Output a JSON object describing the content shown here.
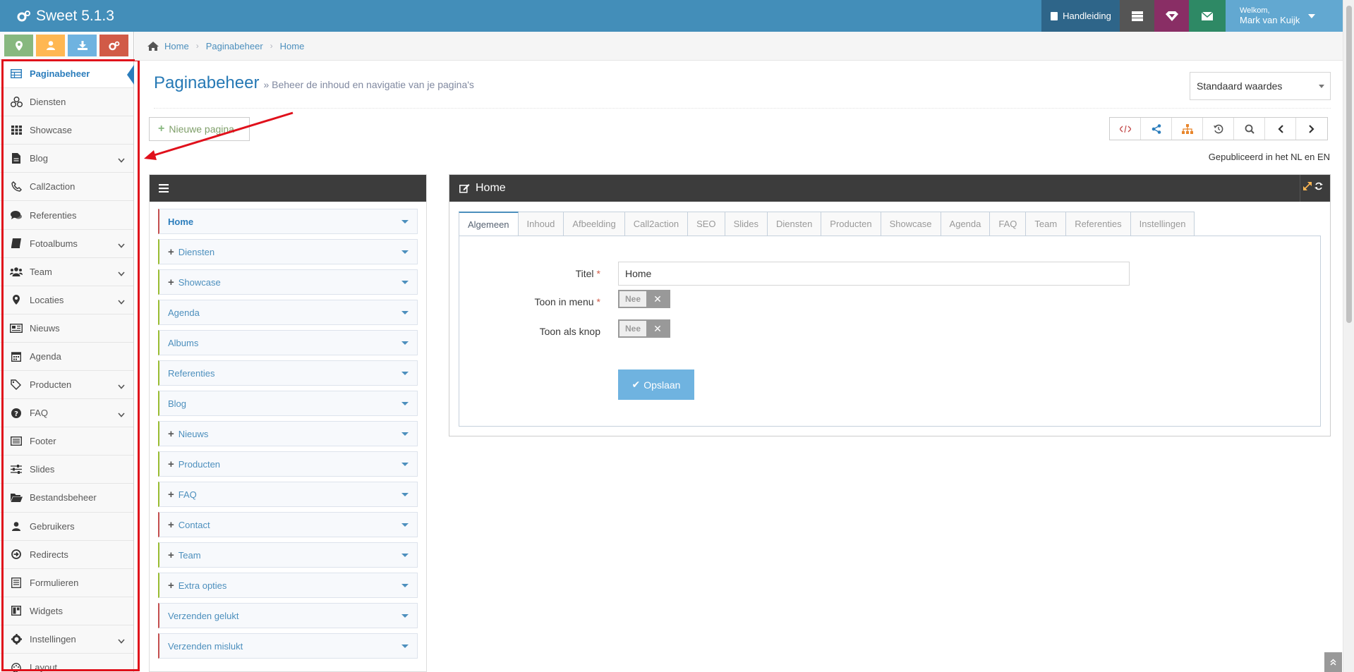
{
  "app": {
    "title": "Sweet 5.1.3",
    "manual_label": "Handleiding",
    "welcome": "Welkom,",
    "user_name": "Mark van Kuijk"
  },
  "colors": {
    "topbar": "#438eb9",
    "accent": "#2b7dbc",
    "highlight": "#e0101b"
  },
  "sidebar": {
    "items": [
      {
        "label": "Paginabeheer",
        "icon": "table-icon",
        "active": true,
        "submenu": false
      },
      {
        "label": "Diensten",
        "icon": "cubes-icon",
        "submenu": false
      },
      {
        "label": "Showcase",
        "icon": "grid-icon",
        "submenu": false
      },
      {
        "label": "Blog",
        "icon": "file-icon",
        "submenu": true
      },
      {
        "label": "Call2action",
        "icon": "phone-icon",
        "submenu": false
      },
      {
        "label": "Referenties",
        "icon": "comments-icon",
        "submenu": false
      },
      {
        "label": "Fotoalbums",
        "icon": "book-icon",
        "submenu": true
      },
      {
        "label": "Team",
        "icon": "users-icon",
        "submenu": true
      },
      {
        "label": "Locaties",
        "icon": "map-marker-icon",
        "submenu": true
      },
      {
        "label": "Nieuws",
        "icon": "newspaper-icon",
        "submenu": false
      },
      {
        "label": "Agenda",
        "icon": "calendar-icon",
        "submenu": false
      },
      {
        "label": "Producten",
        "icon": "tags-icon",
        "submenu": true
      },
      {
        "label": "FAQ",
        "icon": "question-icon",
        "submenu": true
      },
      {
        "label": "Footer",
        "icon": "list-alt-icon",
        "submenu": false
      },
      {
        "label": "Slides",
        "icon": "sliders-icon",
        "submenu": false
      },
      {
        "label": "Bestandsbeheer",
        "icon": "folder-open-icon",
        "submenu": false
      },
      {
        "label": "Gebruikers",
        "icon": "user-icon",
        "submenu": false
      },
      {
        "label": "Redirects",
        "icon": "arrow-circle-icon",
        "submenu": false
      },
      {
        "label": "Formulieren",
        "icon": "form-icon",
        "submenu": false
      },
      {
        "label": "Widgets",
        "icon": "widget-icon",
        "submenu": false
      },
      {
        "label": "Instellingen",
        "icon": "cog-icon",
        "submenu": true
      },
      {
        "label": "Layout",
        "icon": "palette-icon",
        "submenu": false
      }
    ]
  },
  "breadcrumb": [
    "Home",
    "Paginabeheer",
    "Home"
  ],
  "page": {
    "title": "Paginabeheer",
    "subtitle": "» Beheer de inhoud en navigatie van je pagina's",
    "select_value": "Standaard waardes",
    "new_page_label": "Nieuwe pagina",
    "published": "Gepubliceerd in het NL en EN"
  },
  "tree": {
    "items": [
      {
        "label": "Home",
        "plus": false,
        "bar": "red",
        "bold": true
      },
      {
        "label": "Diensten",
        "plus": true,
        "bar": "green"
      },
      {
        "label": "Showcase",
        "plus": true,
        "bar": "green"
      },
      {
        "label": "Agenda",
        "plus": false,
        "bar": "green"
      },
      {
        "label": "Albums",
        "plus": false,
        "bar": "green"
      },
      {
        "label": "Referenties",
        "plus": false,
        "bar": "green"
      },
      {
        "label": "Blog",
        "plus": false,
        "bar": "green"
      },
      {
        "label": "Nieuws",
        "plus": true,
        "bar": "green"
      },
      {
        "label": "Producten",
        "plus": true,
        "bar": "green"
      },
      {
        "label": "FAQ",
        "plus": true,
        "bar": "green"
      },
      {
        "label": "Contact",
        "plus": true,
        "bar": "red"
      },
      {
        "label": "Team",
        "plus": true,
        "bar": "green"
      },
      {
        "label": "Extra opties",
        "plus": true,
        "bar": "green"
      },
      {
        "label": "Verzenden gelukt",
        "plus": false,
        "bar": "red"
      },
      {
        "label": "Verzenden mislukt",
        "plus": false,
        "bar": "red"
      }
    ]
  },
  "widget": {
    "title": "Home",
    "tabs": [
      "Algemeen",
      "Inhoud",
      "Afbeelding",
      "Call2action",
      "SEO",
      "Slides",
      "Diensten",
      "Producten",
      "Showcase",
      "Agenda",
      "FAQ",
      "Team",
      "Referenties",
      "Instellingen"
    ],
    "active_tab": 0,
    "form": {
      "titel_label": "Titel",
      "titel_value": "Home",
      "menu_label": "Toon in menu",
      "menu_value": "Nee",
      "knop_label": "Toon als knop",
      "knop_value": "Nee",
      "save_label": "Opslaan",
      "required_mark": "*"
    }
  }
}
